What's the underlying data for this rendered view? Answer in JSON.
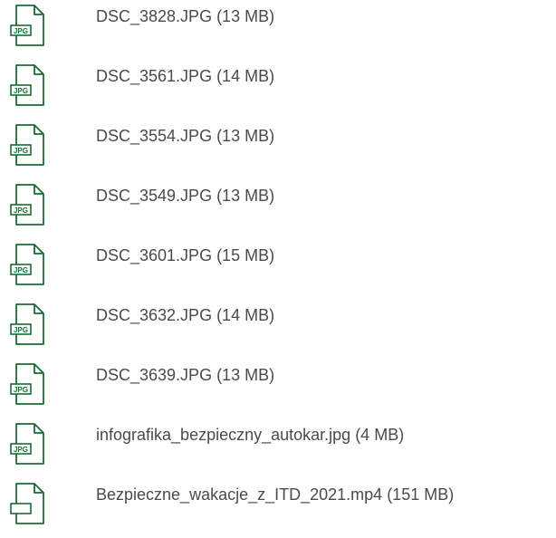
{
  "files": [
    {
      "name": "DSC_3828.JPG (13 MB)",
      "icon": "jpg-file-icon",
      "badge": "JPG"
    },
    {
      "name": "DSC_3561.JPG (14 MB)",
      "icon": "jpg-file-icon",
      "badge": "JPG"
    },
    {
      "name": "DSC_3554.JPG (13 MB)",
      "icon": "jpg-file-icon",
      "badge": "JPG"
    },
    {
      "name": "DSC_3549.JPG (13 MB)",
      "icon": "jpg-file-icon",
      "badge": "JPG"
    },
    {
      "name": "DSC_3601.JPG (15 MB)",
      "icon": "jpg-file-icon",
      "badge": "JPG"
    },
    {
      "name": "DSC_3632.JPG (14 MB)",
      "icon": "jpg-file-icon",
      "badge": "JPG"
    },
    {
      "name": "DSC_3639.JPG (13 MB)",
      "icon": "jpg-file-icon",
      "badge": "JPG"
    },
    {
      "name": "infografika_bezpieczny_autokar.jpg (4 MB)",
      "icon": "jpg-file-icon",
      "badge": "JPG"
    },
    {
      "name": "Bezpieczne_wakacje_z_ITD_2021.mp4 (151 MB)",
      "icon": "file-icon",
      "badge": ""
    }
  ],
  "colors": {
    "icon_green": "#1b6b35",
    "text": "#4a4a4a"
  }
}
